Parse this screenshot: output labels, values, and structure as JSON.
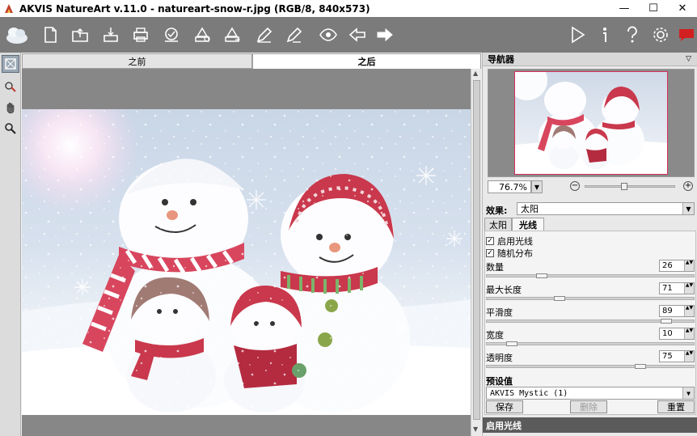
{
  "window": {
    "title": "AKVIS NatureArt v.11.0 - natureart-snow-r.jpg (RGB/8, 840x573)",
    "minimize": "—",
    "maximize": "☐",
    "close": "✕"
  },
  "toolbar": {
    "left_icons": [
      "app-logo",
      "new-file",
      "open-file",
      "save-file",
      "print",
      "batch",
      "preset-download",
      "preset-upload",
      "edit",
      "edit-alt",
      "eye-share",
      "undo-arrow",
      "redo-arrow"
    ],
    "right_icons": [
      "run",
      "info",
      "help",
      "settings",
      "feedback"
    ]
  },
  "tools": [
    "navigator-tool",
    "eyedropper-tool",
    "hand-tool",
    "zoom-tool"
  ],
  "tabs": {
    "before": "之前",
    "after": "之后"
  },
  "navigator": {
    "title": "导航器",
    "zoom_value": "76.7%"
  },
  "effect": {
    "label": "效果:",
    "value": "太阳",
    "tabs": [
      "太阳",
      "光线"
    ],
    "active_tab": "光线"
  },
  "options": {
    "enable_rays": "启用光线",
    "random_distribution": "随机分布"
  },
  "params": [
    {
      "label": "数量",
      "value": "26",
      "fraction": 0.25
    },
    {
      "label": "最大长度",
      "value": "71",
      "fraction": 0.34
    },
    {
      "label": "平滑度",
      "value": "89",
      "fraction": 0.88
    },
    {
      "label": "宽度",
      "value": "10",
      "fraction": 0.1
    },
    {
      "label": "透明度",
      "value": "75",
      "fraction": 0.75
    }
  ],
  "presets": {
    "label": "预设值",
    "value": "AKVIS Mystic (1)",
    "save": "保存",
    "delete": "删除",
    "reset": "重置"
  },
  "status": {
    "title": "启用光线"
  },
  "colors": {
    "toolbar_bg": "#7b7b7b",
    "canvas_bg": "#878787",
    "panel_bg": "#e9e9e9",
    "nav_border": "#d7305b"
  }
}
